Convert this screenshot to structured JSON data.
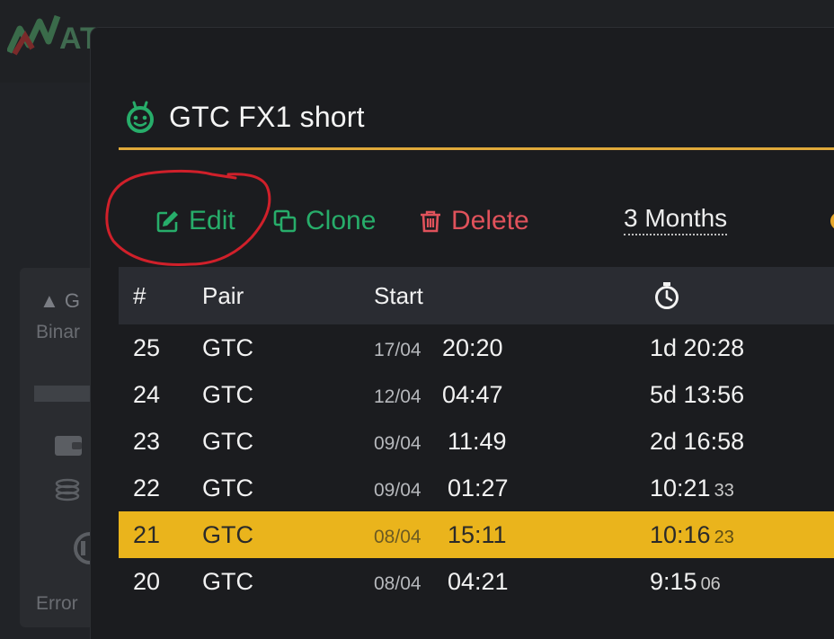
{
  "background": {
    "logo_text": "AT",
    "card_title": "▲ G",
    "card_subtitle": "Binar",
    "card_label": "Error",
    "icons": [
      "wallet-icon",
      "coins-icon",
      "circle-icon"
    ]
  },
  "modal": {
    "bot_icon": "robot-face-icon",
    "title": "GTC FX1 short",
    "accent_color": "#e0a93a"
  },
  "toolbar": {
    "edit_label": "Edit",
    "clone_label": "Clone",
    "delete_label": "Delete",
    "period_label": "3 Months",
    "edit_color": "#27ad6a",
    "delete_color": "#e0525b"
  },
  "table": {
    "headers": {
      "num": "#",
      "pair": "Pair",
      "start": "Start",
      "duration_icon": "stopwatch-icon"
    },
    "rows": [
      {
        "num": "25",
        "pair": "GTC",
        "date": "17/04",
        "time": "20:20",
        "duration": "1d 20:28",
        "seconds": ""
      },
      {
        "num": "24",
        "pair": "GTC",
        "date": "12/04",
        "time": "04:47",
        "duration": "5d 13:56",
        "seconds": ""
      },
      {
        "num": "23",
        "pair": "GTC",
        "date": "09/04",
        "time": "11:49",
        "duration": "2d 16:58",
        "seconds": ""
      },
      {
        "num": "22",
        "pair": "GTC",
        "date": "09/04",
        "time": "01:27",
        "duration": "10:21",
        "seconds": "33"
      },
      {
        "num": "21",
        "pair": "GTC",
        "date": "08/04",
        "time": "15:11",
        "duration": "10:16",
        "seconds": "23",
        "highlighted": true
      },
      {
        "num": "20",
        "pair": "GTC",
        "date": "08/04",
        "time": "04:21",
        "duration": "9:15",
        "seconds": "06"
      }
    ],
    "highlight_color": "#eab41c"
  },
  "annotation": {
    "color": "#d0202a"
  }
}
